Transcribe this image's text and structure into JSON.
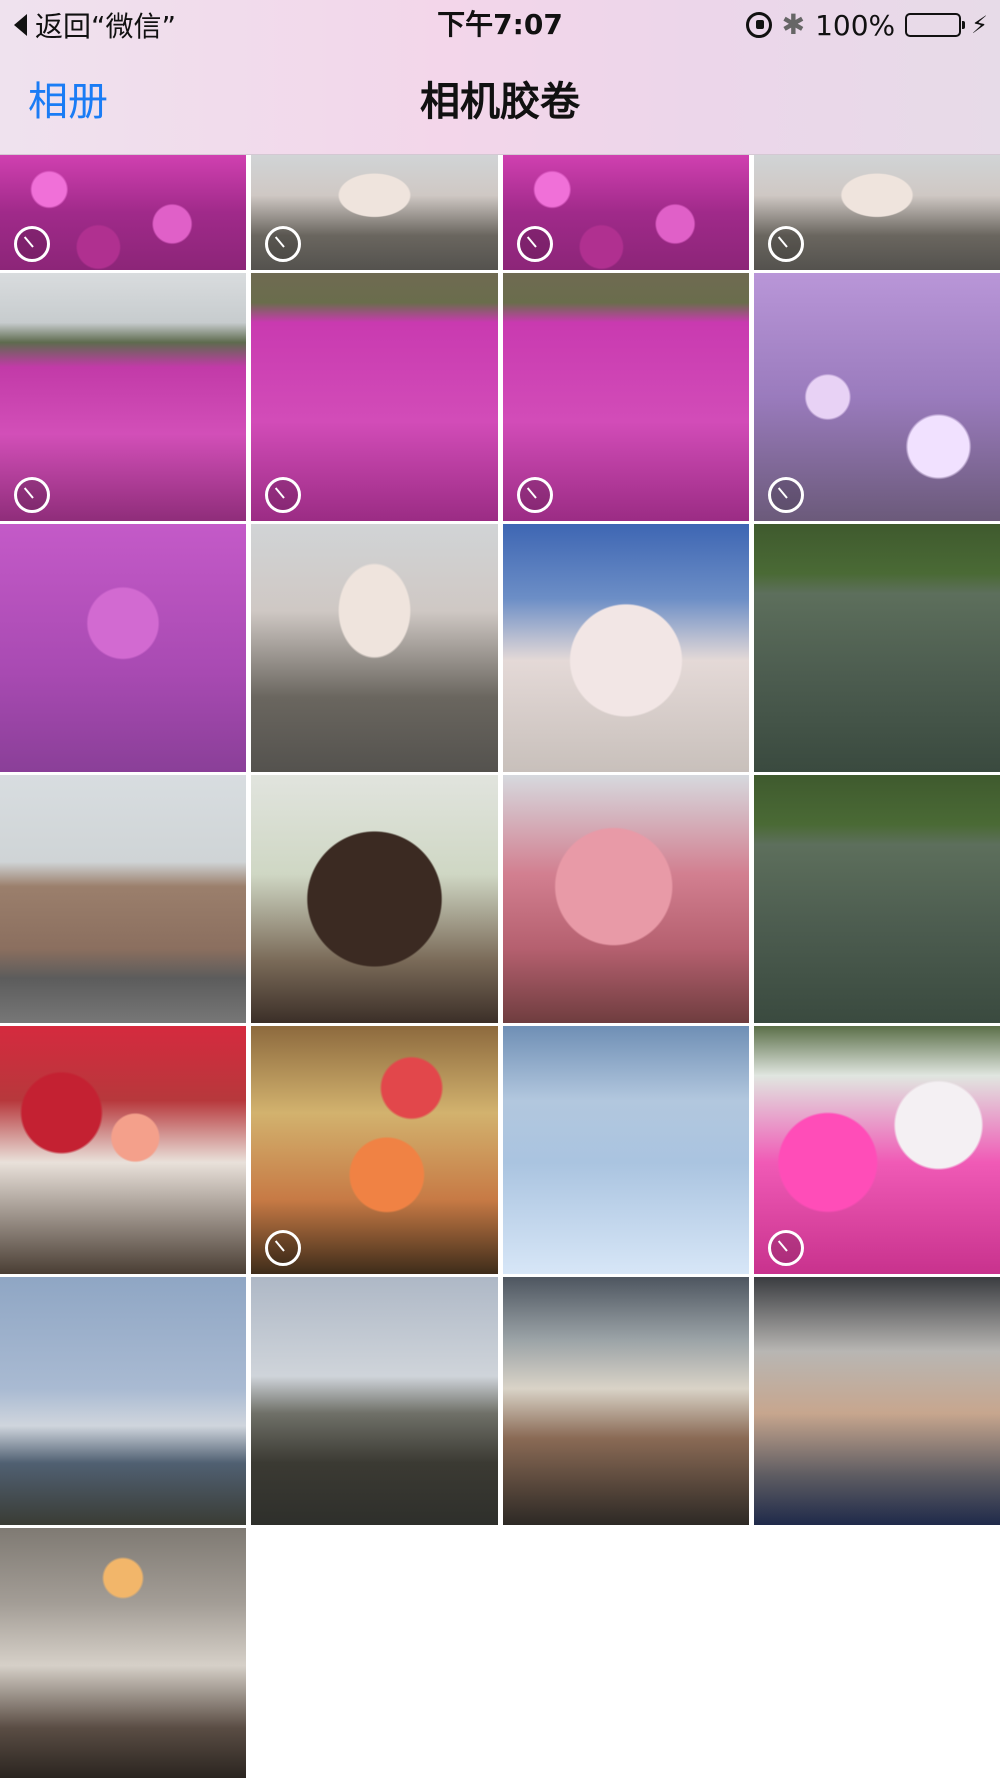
{
  "status_bar": {
    "back_label": "返回“微信”",
    "time": "下午7:07",
    "battery_percent": "100%",
    "battery_level": 1.0,
    "battery_color": "#34c759",
    "icons": [
      "orientation-lock-icon",
      "bluetooth-icon",
      "battery-icon",
      "charging-bolt-icon"
    ]
  },
  "nav": {
    "back_label": "相册",
    "title": "相机胶卷",
    "accent_color": "#1a7cf5"
  },
  "photos": [
    {
      "label": "pink flowers",
      "live": true
    },
    {
      "label": "trees",
      "live": true
    },
    {
      "label": "pink flowers",
      "live": true
    },
    {
      "label": "trees",
      "live": true
    },
    {
      "label": "pink flower field",
      "live": true
    },
    {
      "label": "pink flower field",
      "live": true
    },
    {
      "label": "pink flower field",
      "live": true
    },
    {
      "label": "lilac flowers",
      "live": true
    },
    {
      "label": "pink field",
      "live": false
    },
    {
      "label": "cherry tree street",
      "live": false
    },
    {
      "label": "blossom blue sky",
      "live": false
    },
    {
      "label": "koi pond",
      "live": false
    },
    {
      "label": "church",
      "live": false
    },
    {
      "label": "pagoda",
      "live": false
    },
    {
      "label": "sakura",
      "live": false
    },
    {
      "label": "koi pond",
      "live": false
    },
    {
      "label": "meat plate",
      "live": false
    },
    {
      "label": "sushi",
      "live": true
    },
    {
      "label": "snowy street",
      "live": false
    },
    {
      "label": "azalea flowers",
      "live": true
    },
    {
      "label": "mount fuji",
      "live": false
    },
    {
      "label": "mount fuji",
      "live": false
    },
    {
      "label": "furniture showroom",
      "live": false
    },
    {
      "label": "furniture showroom",
      "live": false
    },
    {
      "label": "bedroom",
      "live": false
    }
  ]
}
